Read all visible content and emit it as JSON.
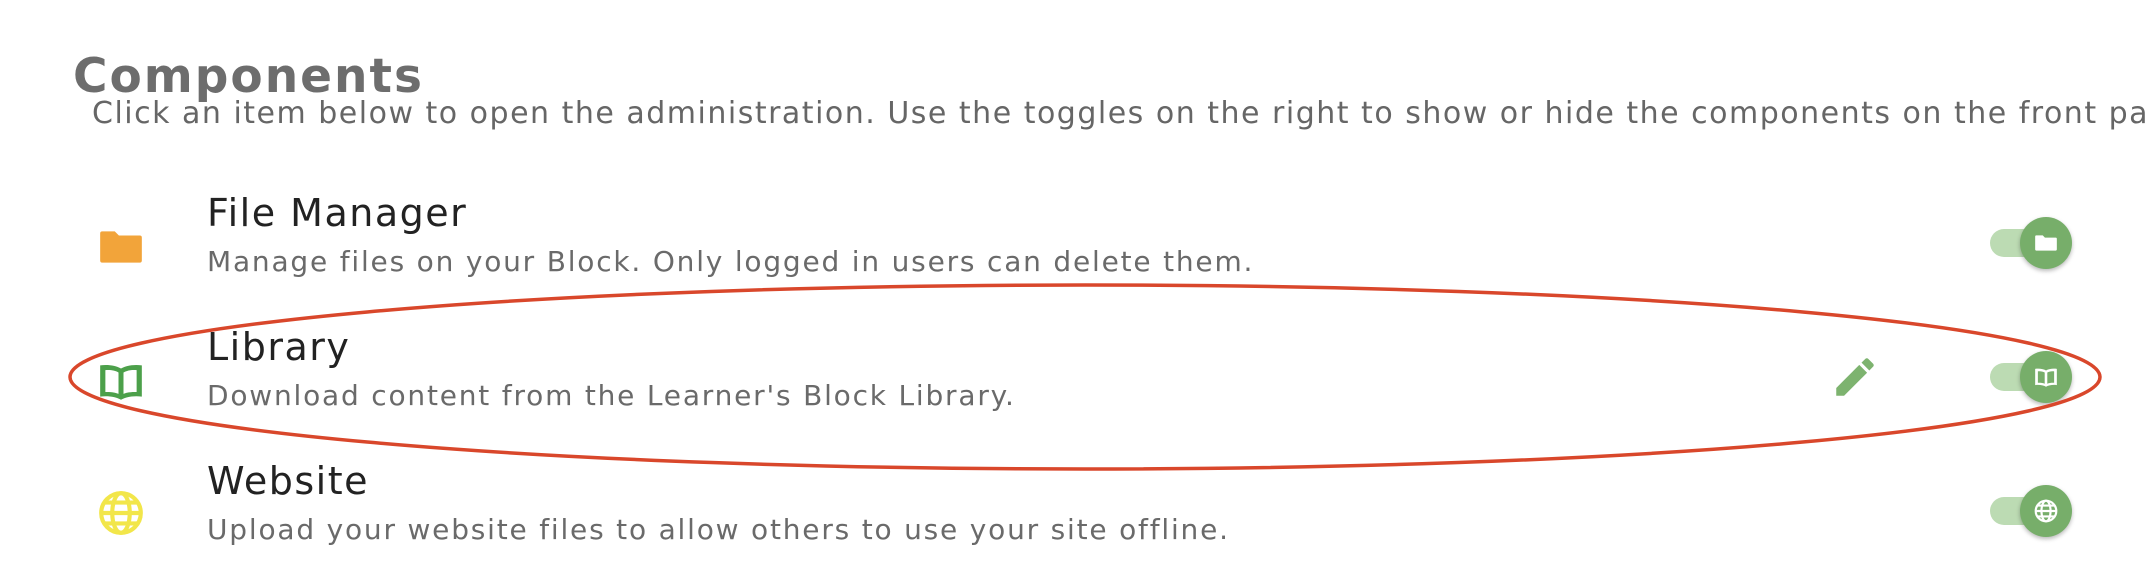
{
  "header": {
    "title": "Components",
    "description": "Click an item below to open the administration. Use the toggles on the right to show or hide the components on the front page."
  },
  "components": [
    {
      "title": "File Manager",
      "description": "Manage files on your Block. Only logged in users can delete them.",
      "icon": "folder-icon",
      "icon_color": "#f2a43a",
      "enabled": true
    },
    {
      "title": "Library",
      "description": "Download content from the Learner's Block Library.",
      "icon": "book-icon",
      "icon_color": "#4ca04a",
      "enabled": true,
      "edit_icon": "pencil-icon"
    },
    {
      "title": "Website",
      "description": "Upload your website files to allow others to use your site offline.",
      "icon": "globe-icon",
      "icon_color": "#f2e64a",
      "enabled": true
    }
  ],
  "colors": {
    "toggle_track": "#bcdbb3",
    "toggle_knob": "#77ae6a",
    "edit_icon": "#7db36f",
    "annotation_ellipse": "#d9472b"
  }
}
